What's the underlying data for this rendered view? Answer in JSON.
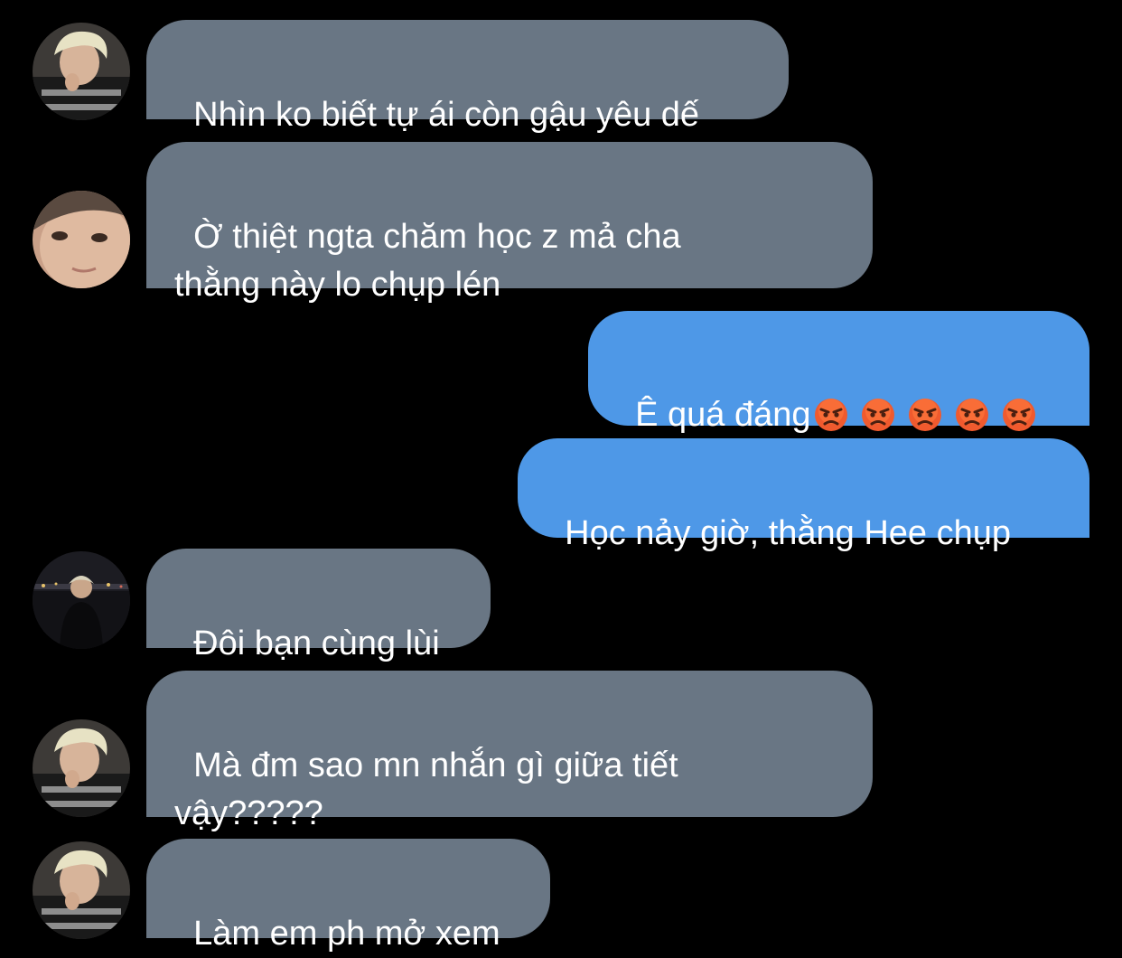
{
  "messages": [
    {
      "id": "m1",
      "side": "incoming",
      "text": "Nhìn ko biết tự ái còn gậu yêu dế",
      "avatar": "blond-boy-avatar"
    },
    {
      "id": "m2",
      "side": "incoming",
      "text": "Ờ thiệt ngta chăm học z mả cha\nthằng này lo chụp lén",
      "avatar": "closeup-face-avatar"
    },
    {
      "id": "m3",
      "side": "outgoing",
      "text": "Ê quá đáng",
      "emojis": [
        "😡",
        "😡",
        "😡",
        "😡",
        "😡"
      ]
    },
    {
      "id": "m4",
      "side": "outgoing",
      "text": "Học nảy giờ, thằng Hee chụp"
    },
    {
      "id": "m5",
      "side": "incoming",
      "text": "Đôi bạn cùng lùi",
      "avatar": "night-city-avatar"
    },
    {
      "id": "m6",
      "side": "incoming",
      "text": "Mà đm sao mn nhắn gì giữa tiết\nvậy?????",
      "avatar": "blond-boy-avatar"
    },
    {
      "id": "m7",
      "side": "incoming",
      "text": "Làm em ph mở xem",
      "avatar": "blond-boy-avatar"
    }
  ],
  "colors": {
    "background": "#000000",
    "incoming_bubble": "#697684",
    "outgoing_bubble": "#4e98e7",
    "text": "#ffffff"
  }
}
